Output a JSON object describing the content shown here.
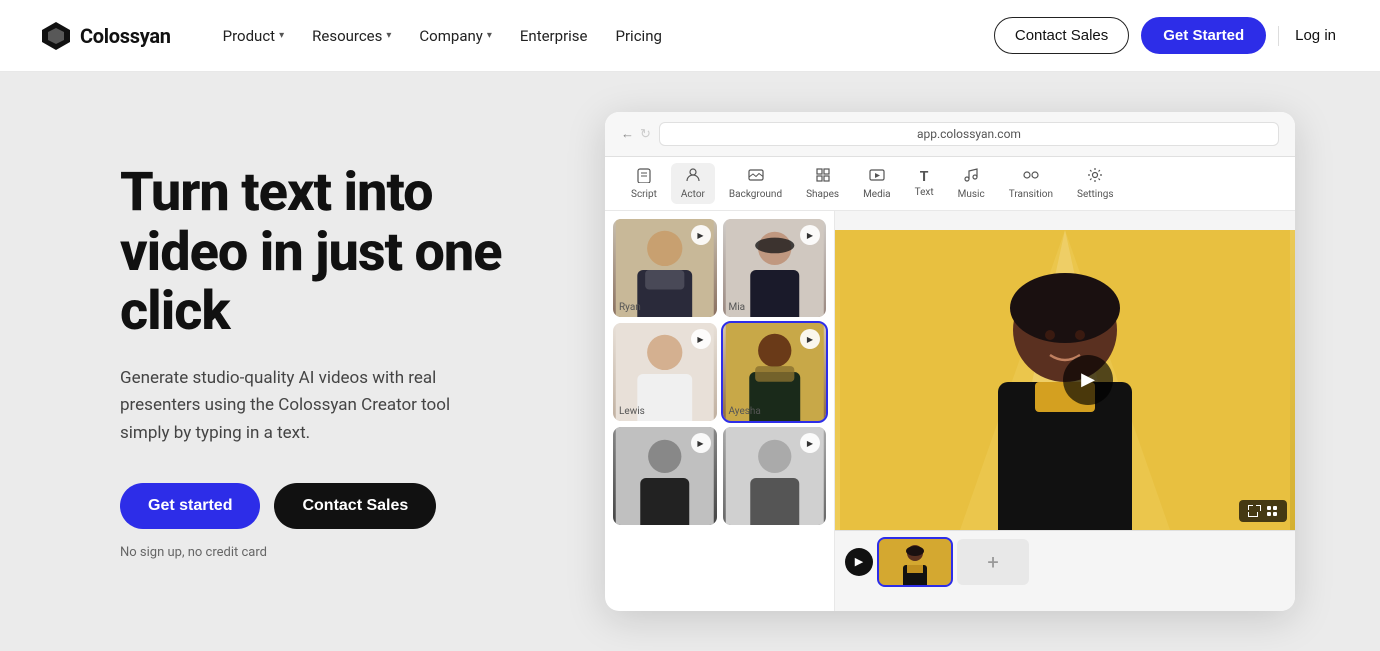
{
  "brand": {
    "name": "Colossyan",
    "logo_alt": "Colossyan logo"
  },
  "nav": {
    "items": [
      {
        "label": "Product",
        "has_dropdown": true
      },
      {
        "label": "Resources",
        "has_dropdown": true
      },
      {
        "label": "Company",
        "has_dropdown": true
      },
      {
        "label": "Enterprise",
        "has_dropdown": false
      },
      {
        "label": "Pricing",
        "has_dropdown": false
      }
    ],
    "contact_sales": "Contact Sales",
    "get_started": "Get Started",
    "login": "Log in"
  },
  "hero": {
    "title": "Turn text into video in just one click",
    "subtitle": "Generate studio-quality AI videos with real presenters using the Colossyan Creator tool simply by typing in a text.",
    "cta_primary": "Get started",
    "cta_secondary": "Contact Sales",
    "no_signup": "No sign up, no credit card"
  },
  "browser": {
    "url": "app.colossyan.com"
  },
  "app_toolbar": {
    "items": [
      {
        "icon": "📄",
        "label": "Script"
      },
      {
        "icon": "👤",
        "label": "Actor"
      },
      {
        "icon": "🖼",
        "label": "Background"
      },
      {
        "icon": "⬛",
        "label": "Shapes"
      },
      {
        "icon": "🖼",
        "label": "Media"
      },
      {
        "icon": "T",
        "label": "Text"
      },
      {
        "icon": "♪",
        "label": "Music"
      },
      {
        "icon": "✦",
        "label": "Transition"
      },
      {
        "icon": "⚙",
        "label": "Settings"
      }
    ]
  },
  "actors": [
    {
      "name": "Ryan",
      "selected": false
    },
    {
      "name": "Mia",
      "selected": false
    },
    {
      "name": "Lewis",
      "selected": false
    },
    {
      "name": "Ayesha",
      "selected": true
    },
    {
      "name": "",
      "selected": false
    },
    {
      "name": "",
      "selected": false
    }
  ],
  "timeline": {
    "add_label": "+"
  }
}
